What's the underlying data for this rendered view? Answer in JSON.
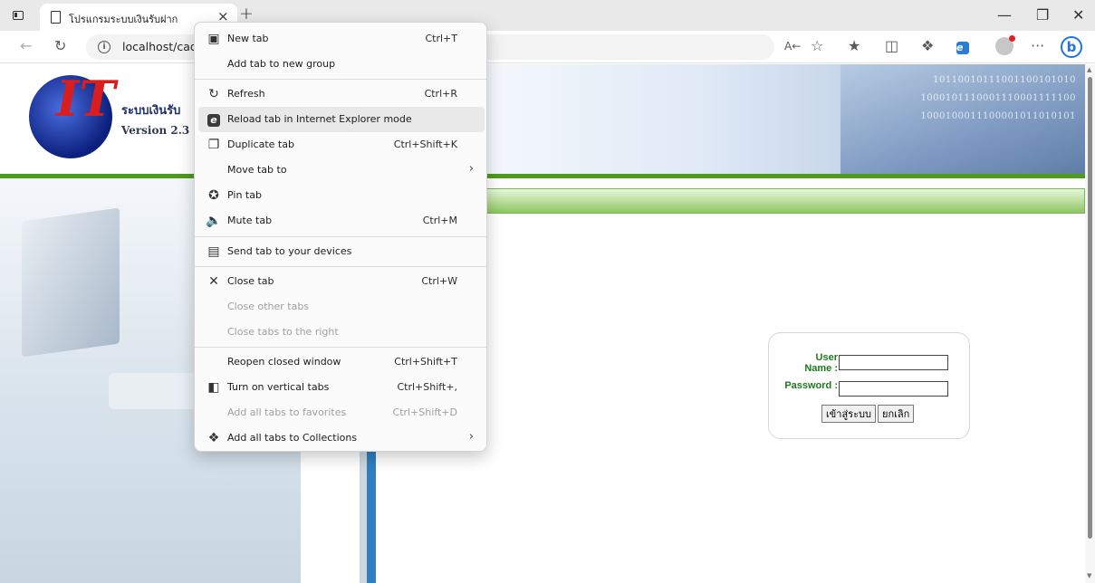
{
  "browser": {
    "tab_title": "โปรแกรมระบบเงินรับฝาก",
    "url": "localhost/cad_",
    "tab_close_glyph": "×",
    "new_tab_glyph": "+",
    "more_glyph": "···",
    "bing_glyph": "b"
  },
  "context_menu": {
    "items": [
      {
        "label": "New tab",
        "shortcut": "Ctrl+T",
        "icon": "new-tab-icon"
      },
      {
        "label": "Add tab to new group",
        "shortcut": "",
        "icon": ""
      },
      {
        "label": "Refresh",
        "shortcut": "Ctrl+R",
        "icon": "refresh-icon"
      },
      {
        "label": "Reload tab in Internet Explorer mode",
        "shortcut": "",
        "icon": "ie-mode-icon"
      },
      {
        "label": "Duplicate tab",
        "shortcut": "Ctrl+Shift+K",
        "icon": "duplicate-icon"
      },
      {
        "label": "Move tab to",
        "shortcut": "",
        "icon": "",
        "submenu": true
      },
      {
        "label": "Pin tab",
        "shortcut": "",
        "icon": "pin-icon"
      },
      {
        "label": "Mute tab",
        "shortcut": "Ctrl+M",
        "icon": "mute-icon"
      },
      {
        "label": "Send tab to your devices",
        "shortcut": "",
        "icon": "devices-icon"
      },
      {
        "label": "Close tab",
        "shortcut": "Ctrl+W",
        "icon": "close-icon"
      },
      {
        "label": "Close other tabs",
        "shortcut": "",
        "icon": "",
        "disabled": true
      },
      {
        "label": "Close tabs to the right",
        "shortcut": "",
        "icon": "",
        "disabled": true
      },
      {
        "label": "Reopen closed window",
        "shortcut": "Ctrl+Shift+T",
        "icon": ""
      },
      {
        "label": "Turn on vertical tabs",
        "shortcut": "Ctrl+Shift+,",
        "icon": "vertical-tabs-icon"
      },
      {
        "label": "Add all tabs to favorites",
        "shortcut": "Ctrl+Shift+D",
        "icon": "",
        "disabled": true
      },
      {
        "label": "Add all tabs to Collections",
        "shortcut": "",
        "icon": "collections-icon",
        "submenu": true
      }
    ]
  },
  "page": {
    "brand": "ระบบเงินรับ",
    "version": "Version 2.3",
    "logo_text": "IT",
    "binary_lines": [
      "10110010111001100101010",
      "1000101110001110001111100",
      "1000100011100001011010101"
    ],
    "login": {
      "user_label": "User Name :",
      "password_label": "Password :",
      "user_value": "",
      "password_value": "",
      "login_button": "เข้าสู่ระบบ",
      "cancel_button": "ยกเลิก"
    }
  },
  "colors": {
    "accent_green": "#4e9a1f",
    "label_green": "#1d7a1d",
    "accent_blue": "#2f7fc1",
    "logo_red": "#d81e1e"
  }
}
